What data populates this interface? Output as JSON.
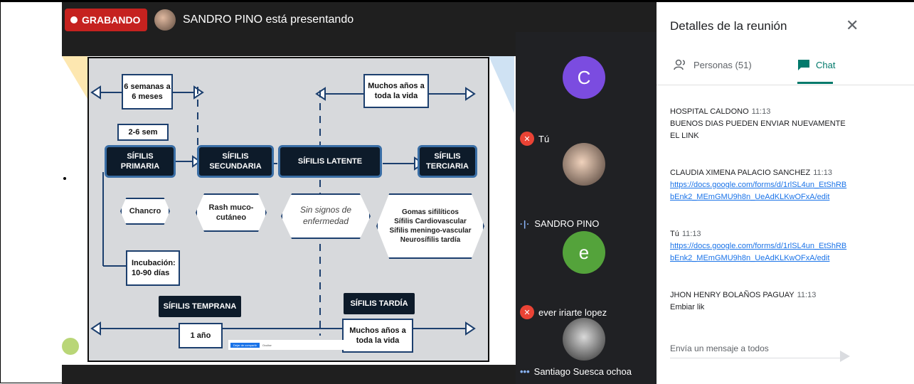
{
  "recording": {
    "label": "GRABANDO"
  },
  "presenter": {
    "text": "SANDRO PINO está presentando"
  },
  "slide": {
    "boxes": {
      "weeks": "6 semanas a\n6 meses",
      "weeks_short": "2-6 sem",
      "years_top": "Muchos años a\ntoda la vida",
      "primary": "SÍFILIS\nPRIMARIA",
      "secondary": "SÍFILIS\nSECUNDARIA",
      "latent": "SÍFILIS LATENTE",
      "tertiary": "SÍFILIS\nTERCIARIA",
      "chancre": "Chancro",
      "rash": "Rash muco-\ncutáneo",
      "no_signs": "Sin signos de\nenfermedad",
      "gomas": "Gomas sifilíticos\nSífilis Cardiovascular\nSífilis meningo-vascular\nNeurosífilis tardía",
      "incubation": "Incubación:\n10-90 días",
      "early": "SÍFILIS TEMPRANA",
      "late": "SÍFILIS TARDÍA",
      "one_year": "1 año",
      "years_bottom": "Muchos años a\ntoda la vida"
    },
    "toast": {
      "button": "Dejar de compartir",
      "dismiss": "Ocultar"
    }
  },
  "participants": [
    {
      "name": "Tú",
      "initial": "C",
      "color": "#7b4ce0",
      "mic": "off"
    },
    {
      "name": "SANDRO PINO",
      "mic": "speaking"
    },
    {
      "name": "ever iriarte lopez",
      "initial": "e",
      "color": "#54a33b",
      "mic": "off"
    },
    {
      "name": "Santiago Suesca ochoa",
      "mic": "on"
    }
  ],
  "panel": {
    "title": "Detalles de la reunión",
    "tabs": {
      "people": "Personas (51)",
      "chat": "Chat"
    },
    "messages": [
      {
        "sender": "HOSPITAL CALDONO",
        "time": "11:13",
        "text": "BUENOS DIAS PUEDEN ENVIAR NUEVAMENTE EL LINK"
      },
      {
        "sender": "CLAUDIA XIMENA PALACIO SANCHEZ",
        "time": "11:13",
        "link": "https://docs.google.com/forms/d/1rlSL4un_EtShRBbEnk2_MEmGMU9h8n_UeAdKLKwOFxA/edit"
      },
      {
        "sender": "Tú",
        "time": "11:13",
        "link": "https://docs.google.com/forms/d/1rlSL4un_EtShRBbEnk2_MEmGMU9h8n_UeAdKLKwOFxA/edit"
      },
      {
        "sender": "JHON HENRY BOLAÑOS PAGUAY",
        "time": "11:13",
        "text": "Embiar lik"
      }
    ],
    "compose_placeholder": "Envía un mensaje a todos"
  },
  "colors": {
    "record": "#c5221f",
    "chat_accent": "#00796b",
    "link": "#1a73e8"
  }
}
